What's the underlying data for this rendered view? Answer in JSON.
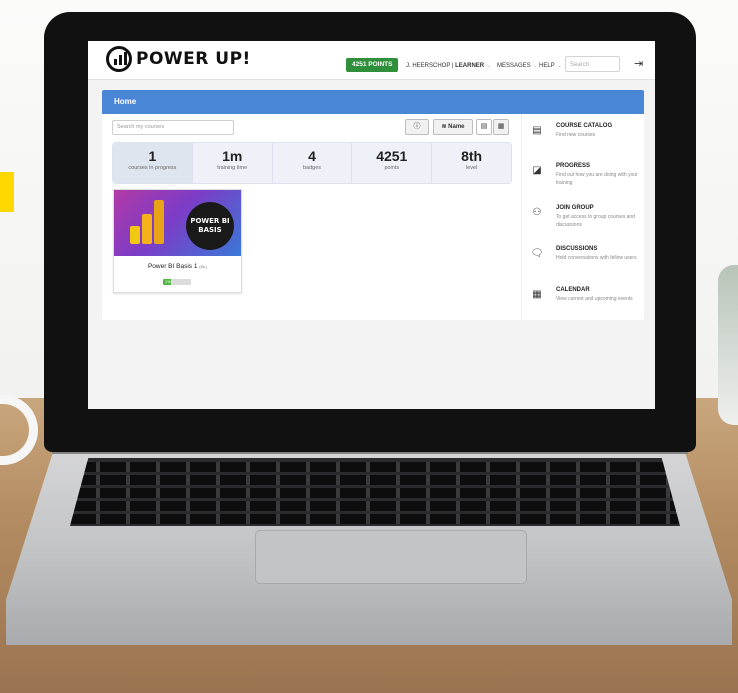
{
  "app": {
    "logo_text": "POWER UP!",
    "points_button": "4251 POINTS",
    "user_name": "J. HEERSCHOP |",
    "user_role": "LEARNER",
    "messages": "MESSAGES",
    "help": "HELP",
    "search_placeholder": "Search"
  },
  "panel": {
    "title": "Home",
    "search_placeholder": "Search my courses",
    "sort_label": "Name"
  },
  "stats": [
    {
      "value": "1",
      "label": "courses in progress"
    },
    {
      "value": "1m",
      "label": "training time"
    },
    {
      "value": "4",
      "label": "badges"
    },
    {
      "value": "4251",
      "label": "points"
    },
    {
      "value": "8th",
      "label": "level"
    }
  ],
  "course": {
    "title": "Power BI Basis 1",
    "tag": "(NL)",
    "badge_line1": "POWER BI",
    "badge_line2": "BASIS",
    "progress_label": "1%",
    "progress": 0.3
  },
  "sidebar": [
    {
      "title": "COURSE CATALOG",
      "desc": "Find new courses",
      "icon": "book-icon"
    },
    {
      "title": "PROGRESS",
      "desc": "Find out how you are doing with your training",
      "icon": "chart-icon"
    },
    {
      "title": "JOIN GROUP",
      "desc": "To get access to group courses and discussions",
      "icon": "group-icon"
    },
    {
      "title": "DISCUSSIONS",
      "desc": "Hold conversations with fellow users",
      "icon": "chat-icon"
    },
    {
      "title": "CALENDAR",
      "desc": "View current and upcoming events",
      "icon": "calendar-icon"
    }
  ],
  "colors": {
    "header_blue": "#4a86d6",
    "points_green": "#2f8f3a",
    "progress_green": "#53b746"
  }
}
